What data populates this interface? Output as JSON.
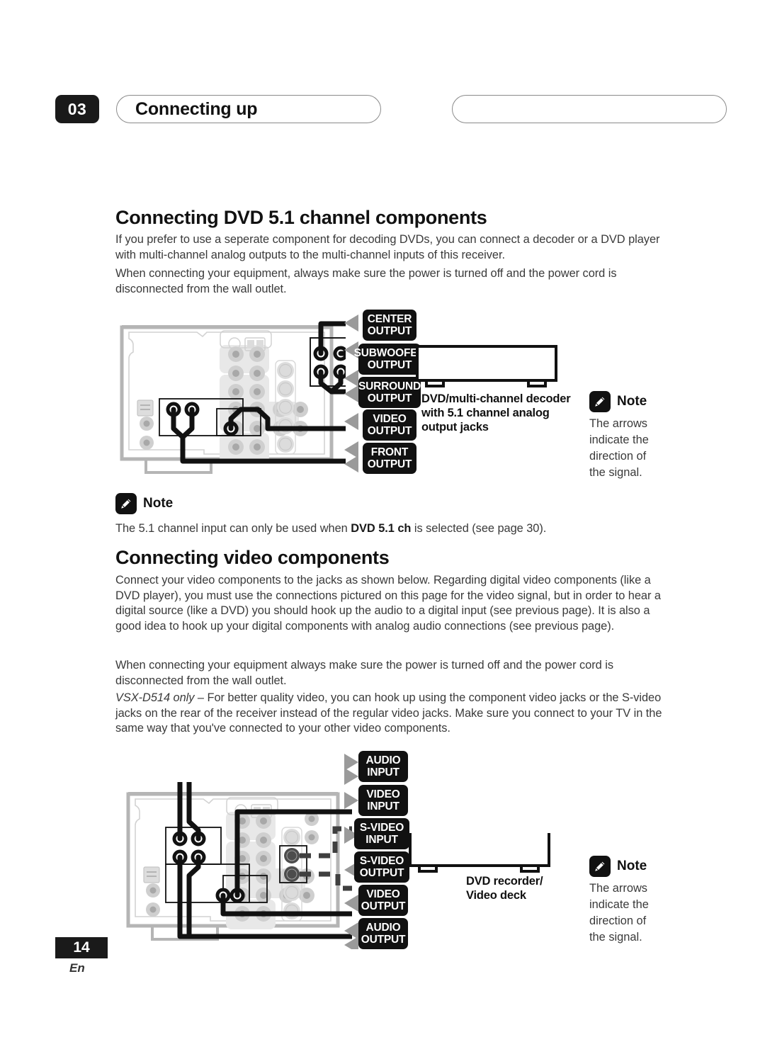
{
  "header": {
    "chapter_number": "03",
    "chapter_title": "Connecting up",
    "right_pill_text": ""
  },
  "sections": [
    {
      "heading": "Connecting DVD 5.1 channel components",
      "paragraphs": [
        "If you prefer to use a seperate component for decoding DVDs, you can connect a decoder or a DVD player with multi-channel analog outputs to the multi-channel inputs of this receiver.",
        "When connecting your equipment, always make sure the power is turned off and the power cord is disconnected from the wall outlet."
      ]
    },
    {
      "heading": "Connecting video components",
      "paragraphs": [
        "Connect your video components to the jacks as shown below. Regarding digital video components (like a DVD player), you must use the connections pictured on this page for the video signal, but in order to hear a digital source (like a DVD) you should hook up the audio to a digital input (see previous page). It is also a good idea to hook up your digital components with analog audio connections (see previous page).",
        "When connecting your equipment always make sure the power is turned off and the power cord is disconnected from the wall outlet."
      ],
      "italic_paragraph": {
        "lead_italic": "VSX-D514 only",
        "rest": " – For better quality video, you can hook up using the component video jacks or the S-video jacks on the rear of the receiver instead of the regular video jacks. Make sure you connect to your TV in the same way that you've connected to your other video components."
      }
    }
  ],
  "diagram1": {
    "labels": [
      {
        "line1": "CENTER",
        "line2": "OUTPUT"
      },
      {
        "line1": "SUBWOOFER",
        "line2": "OUTPUT"
      },
      {
        "line1": "SURROUND",
        "line2": "OUTPUT"
      },
      {
        "line1": "VIDEO",
        "line2": "OUTPUT"
      },
      {
        "line1": "FRONT",
        "line2": "OUTPUT"
      }
    ],
    "device_label": "DVD/multi-channel decoder with 5.1 channel analog output jacks",
    "device_label_lines": [
      "DVD/multi-channel decoder",
      "with 5.1 channel analog",
      "output jacks"
    ],
    "side_note": {
      "icon": "pencil-icon",
      "title": "Note",
      "lines": [
        "The arrows",
        "indicate the",
        "direction of",
        "the signal."
      ]
    }
  },
  "note_below_diagram1": {
    "icon": "pencil-icon",
    "title": "Note",
    "text_before": "The 5.1 channel input can only be used when ",
    "text_bold": "DVD 5.1 ch",
    "text_after": " is selected (see page 30)."
  },
  "diagram2": {
    "labels": [
      {
        "line1": "AUDIO",
        "line2": "INPUT",
        "direction": "right"
      },
      {
        "line1": "VIDEO",
        "line2": "INPUT",
        "direction": "right"
      },
      {
        "line1": "S-VIDEO",
        "line2": "INPUT",
        "direction": "right"
      },
      {
        "line1": "S-VIDEO",
        "line2": "OUTPUT",
        "direction": "left"
      },
      {
        "line1": "VIDEO",
        "line2": "OUTPUT",
        "direction": "left"
      },
      {
        "line1": "AUDIO",
        "line2": "OUTPUT",
        "direction": "left"
      }
    ],
    "device_label_lines": [
      "DVD recorder/",
      "Video deck"
    ],
    "side_note": {
      "icon": "pencil-icon",
      "title": "Note",
      "lines": [
        "The arrows",
        "indicate the",
        "direction of",
        "the signal."
      ]
    }
  },
  "footer": {
    "page_number": "14",
    "language": "En"
  },
  "colors": {
    "ink": "#231f20",
    "chip_bg": "#111111",
    "arrow_gray": "#9a9a9a",
    "panel_gray": "#b5b5b5",
    "jack_gray": "#cfcfcf",
    "svideo_dash": "#3f3f3f"
  }
}
